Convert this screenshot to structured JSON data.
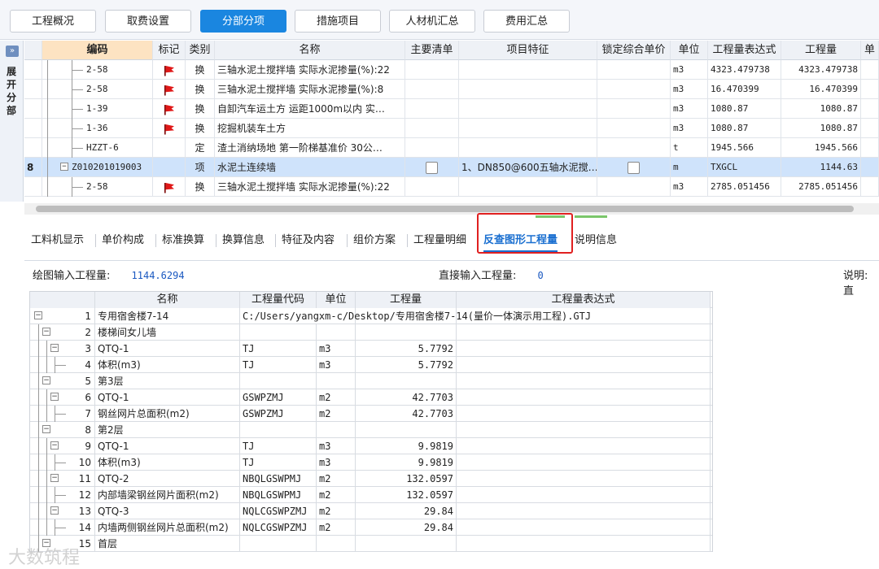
{
  "toolbar": {
    "buttons": [
      "工程概况",
      "取费设置",
      "分部分项",
      "措施项目",
      "人材机汇总",
      "费用汇总"
    ],
    "active_index": 2
  },
  "sidebar": {
    "expand_glyph": "»",
    "label": "展开分部"
  },
  "top_grid": {
    "headers": [
      "编码",
      "标记",
      "类别",
      "名称",
      "主要清单",
      "项目特征",
      "锁定综合单价",
      "单位",
      "工程量表达式",
      "工程量",
      "单"
    ],
    "rows": [
      {
        "num": "",
        "code": "2-58",
        "flag": true,
        "type": "换",
        "name": "三轴水泥土搅拌墙  实际水泥掺量(%):22",
        "main": false,
        "feature": "",
        "lock": false,
        "unit": "m3",
        "expr": "4323.479738",
        "qty": "4323.479738"
      },
      {
        "num": "",
        "code": "2-58",
        "flag": true,
        "type": "换",
        "name": "三轴水泥土搅拌墙  实际水泥掺量(%):8",
        "main": false,
        "feature": "",
        "lock": false,
        "unit": "m3",
        "expr": "16.470399",
        "qty": "16.470399"
      },
      {
        "num": "",
        "code": "1-39",
        "flag": true,
        "type": "换",
        "name": "自卸汽车运土方 运距1000m以内  实…",
        "main": false,
        "feature": "",
        "lock": false,
        "unit": "m3",
        "expr": "1080.87",
        "qty": "1080.87"
      },
      {
        "num": "",
        "code": "1-36",
        "flag": true,
        "type": "换",
        "name": "挖掘机装车土方",
        "main": false,
        "feature": "",
        "lock": false,
        "unit": "m3",
        "expr": "1080.87",
        "qty": "1080.87"
      },
      {
        "num": "",
        "code": "HZZT-6",
        "flag": false,
        "type": "定",
        "name": "渣土消纳场地 第一阶梯基准价 30公…",
        "main": false,
        "feature": "",
        "lock": false,
        "unit": "t",
        "expr": "1945.566",
        "qty": "1945.566"
      },
      {
        "num": "8",
        "code": "Z010201019003",
        "flag": false,
        "type": "项",
        "name": "水泥土连续墙",
        "main": true,
        "feature": "1、DN850@600五轴水泥搅…",
        "lock": true,
        "unit": "m",
        "expr": "TXGCL",
        "qty": "1144.63"
      },
      {
        "num": "",
        "code": "2-58",
        "flag": true,
        "type": "换",
        "name": "三轴水泥土搅拌墙  实际水泥掺量(%):22",
        "main": false,
        "feature": "",
        "lock": false,
        "unit": "m3",
        "expr": "2785.051456",
        "qty": "2785.051456"
      }
    ]
  },
  "tabs": [
    "工料机显示",
    "单价构成",
    "标准换算",
    "换算信息",
    "特征及内容",
    "组价方案",
    "工程量明细",
    "反查图形工程量",
    "说明信息"
  ],
  "active_tab": 7,
  "info": {
    "draw_label": "绘图输入工程量:",
    "draw_value": "1144.6294",
    "direct_label": "直接输入工程量:",
    "direct_value": "0",
    "note_label": "说明: 直"
  },
  "bottom_grid": {
    "headers": [
      "名称",
      "工程量代码",
      "单位",
      "工程量",
      "工程量表达式"
    ],
    "rows": [
      {
        "level": 0,
        "box": "−",
        "num": "1",
        "name": "专用宿舍楼7-14",
        "code": "C:/Users/yangxm-c/Desktop/专用宿舍楼7-14(量价一体演示用工程).GTJ",
        "unit": "",
        "qty": "",
        "expr": ""
      },
      {
        "level": 1,
        "box": "−",
        "num": "2",
        "name": "楼梯间女儿墙",
        "code": "",
        "unit": "",
        "qty": "",
        "expr": ""
      },
      {
        "level": 2,
        "box": "−",
        "num": "3",
        "name": "QTQ-1",
        "code": "TJ",
        "unit": "m3",
        "qty": "5.7792",
        "expr": ""
      },
      {
        "level": 3,
        "box": "",
        "num": "4",
        "name": "体积(m3)",
        "code": "TJ",
        "unit": "m3",
        "qty": "5.7792",
        "expr": ""
      },
      {
        "level": 1,
        "box": "−",
        "num": "5",
        "name": "第3层",
        "code": "",
        "unit": "",
        "qty": "",
        "expr": ""
      },
      {
        "level": 2,
        "box": "−",
        "num": "6",
        "name": "QTQ-1",
        "code": "GSWPZMJ",
        "unit": "m2",
        "qty": "42.7703",
        "expr": ""
      },
      {
        "level": 3,
        "box": "",
        "num": "7",
        "name": "钢丝网片总面积(m2)",
        "code": "GSWPZMJ",
        "unit": "m2",
        "qty": "42.7703",
        "expr": ""
      },
      {
        "level": 1,
        "box": "−",
        "num": "8",
        "name": "第2层",
        "code": "",
        "unit": "",
        "qty": "",
        "expr": ""
      },
      {
        "level": 2,
        "box": "−",
        "num": "9",
        "name": "QTQ-1",
        "code": "TJ",
        "unit": "m3",
        "qty": "9.9819",
        "expr": ""
      },
      {
        "level": 3,
        "box": "",
        "num": "10",
        "name": "体积(m3)",
        "code": "TJ",
        "unit": "m3",
        "qty": "9.9819",
        "expr": ""
      },
      {
        "level": 2,
        "box": "−",
        "num": "11",
        "name": "QTQ-2",
        "code": "NBQLGSWPMJ",
        "unit": "m2",
        "qty": "132.0597",
        "expr": ""
      },
      {
        "level": 3,
        "box": "",
        "num": "12",
        "name": "内部墙梁钢丝网片面积(m2)",
        "code": "NBQLGSWPMJ",
        "unit": "m2",
        "qty": "132.0597",
        "expr": ""
      },
      {
        "level": 2,
        "box": "−",
        "num": "13",
        "name": "QTQ-3",
        "code": "NQLCGSWPZMJ",
        "unit": "m2",
        "qty": "29.84",
        "expr": ""
      },
      {
        "level": 3,
        "box": "",
        "num": "14",
        "name": "内墙两侧钢丝网片总面积(m2)",
        "code": "NQLCGSWPZMJ",
        "unit": "m2",
        "qty": "29.84",
        "expr": ""
      },
      {
        "level": 1,
        "box": "−",
        "num": "15",
        "name": "首层",
        "code": "",
        "unit": "",
        "qty": "",
        "expr": ""
      }
    ]
  },
  "watermark": "大数筑程",
  "colors": {
    "accent": "#1a86e0",
    "flag": "#e01818",
    "highlight_box": "#e02020",
    "selected_row": "#cfe3fb"
  }
}
